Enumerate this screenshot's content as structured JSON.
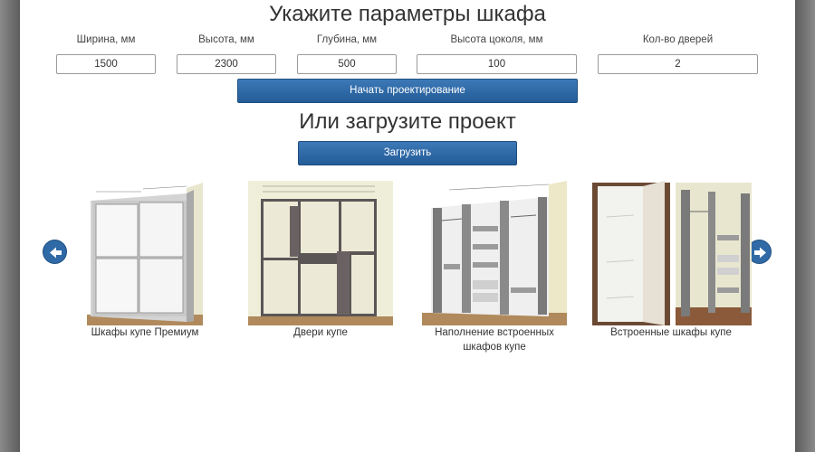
{
  "form": {
    "title": "Укажите параметры шкафа",
    "params": [
      {
        "label": "Ширина, мм",
        "value": "1500"
      },
      {
        "label": "Высота, мм",
        "value": "2300"
      },
      {
        "label": "Глубина, мм",
        "value": "500"
      },
      {
        "label": "Высота цоколя, мм",
        "value": "100"
      },
      {
        "label": "Кол-во дверей",
        "value": "2"
      }
    ],
    "start_button": "Начать проектирование"
  },
  "upload": {
    "title": "Или загрузите проект",
    "button": "Загрузить"
  },
  "carousel": {
    "items": [
      {
        "caption": "Шкафы купе Премиум",
        "icon": "sliding-wardrobe-image"
      },
      {
        "caption": "Двери купе",
        "icon": "sliding-doors-image"
      },
      {
        "caption": "Наполнение встроенных шкафов купе",
        "icon": "wardrobe-interior-image"
      },
      {
        "caption": "Встроенные шкафы купе",
        "icon": "built-in-wardrobe-image"
      }
    ],
    "prev_icon": "arrow-left-icon",
    "next_icon": "arrow-right-icon"
  },
  "colors": {
    "button": "#2f6aa6",
    "background": "#ffffff",
    "frame": "#6e6e6e"
  }
}
